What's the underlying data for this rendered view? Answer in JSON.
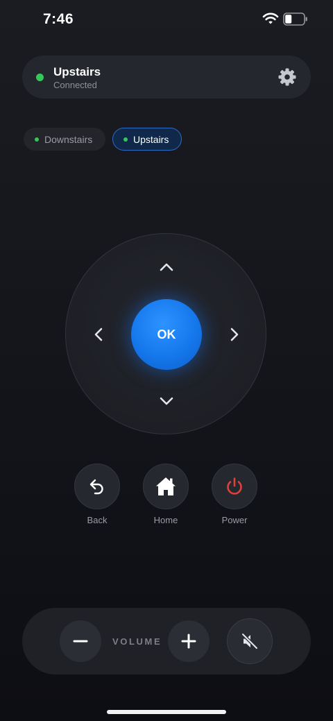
{
  "status_bar": {
    "time": "7:46",
    "battery_level": 0.35,
    "icons": [
      "wifi-icon",
      "battery-icon"
    ]
  },
  "device": {
    "name": "Upstairs",
    "status": "Connected",
    "status_color": "#34c759",
    "settings_icon": "gear-icon"
  },
  "devices": [
    {
      "label": "Downstairs",
      "selected": false
    },
    {
      "label": "Upstairs",
      "selected": true
    }
  ],
  "dpad": {
    "ok_label": "OK",
    "icons": [
      "chevron-up-icon",
      "chevron-down-icon",
      "chevron-left-icon",
      "chevron-right-icon"
    ]
  },
  "controls": {
    "back": {
      "label": "Back",
      "icon": "back-arrow-icon"
    },
    "home": {
      "label": "Home",
      "icon": "house-icon"
    },
    "power": {
      "label": "Power",
      "icon": "power-icon",
      "color": "#e0403a"
    }
  },
  "volume": {
    "label": "VOLUME",
    "icons": [
      "minus-icon",
      "plus-icon",
      "mute-icon"
    ]
  },
  "colors": {
    "accent": "#1477ec",
    "background": "#14161c",
    "power": "#e0403a",
    "online": "#34c759"
  }
}
